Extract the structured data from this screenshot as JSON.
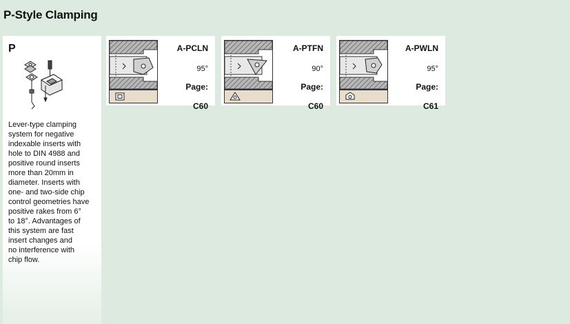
{
  "page": {
    "title": "P-Style Clamping"
  },
  "panel": {
    "letter": "P",
    "description": "Lever-type clamping\nsystem for negative\nindexable inserts with\nhole to DIN 4988 and\npositive round inserts\nmore than 20mm in\ndiameter. Inserts with\none- and two-side chip\ncontrol geometries have\npositive rakes from 6°\nto 18°. Advantages of\nthis system are fast\ninsert changes and\nno interference with\nchip flow."
  },
  "tools": [
    {
      "code": "A-PCLN",
      "angle": "95°",
      "page_label": "Page:",
      "page_ref": "C60",
      "insert_icon": "square-insert-icon"
    },
    {
      "code": "A-PTFN",
      "angle": "90°",
      "page_label": "Page:",
      "page_ref": "C60",
      "insert_icon": "triangle-insert-icon"
    },
    {
      "code": "A-PWLN",
      "angle": "95°",
      "page_label": "Page:",
      "page_ref": "C61",
      "insert_icon": "trigon-insert-icon"
    }
  ],
  "colors": {
    "background": "#dceadf",
    "card": "#ffffff",
    "insert_tag": "#e8dccb",
    "hatch_fill": "#a9a9a9"
  }
}
